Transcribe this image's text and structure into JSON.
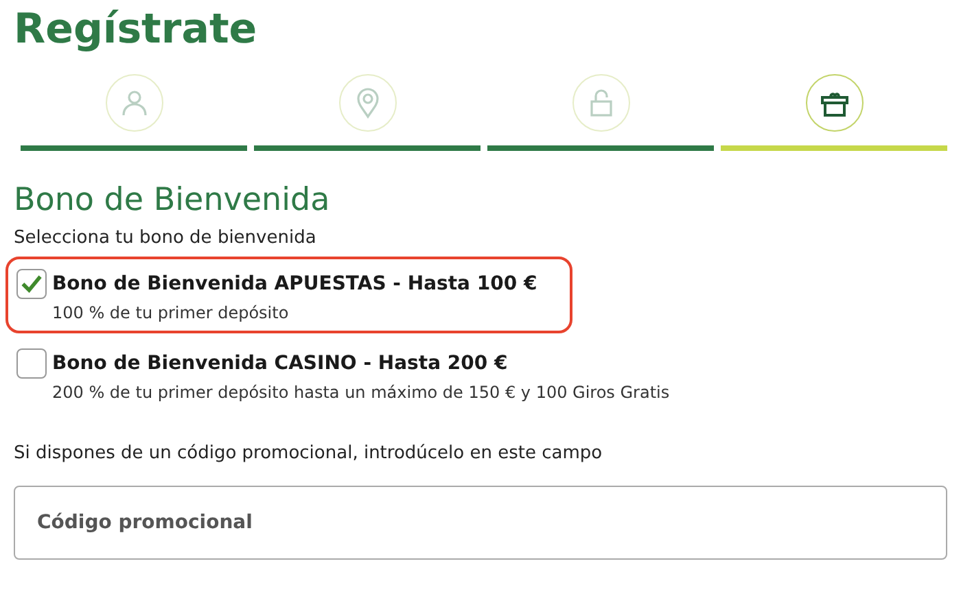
{
  "title": "Regístrate",
  "steps": [
    {
      "kind": "user",
      "selected": false
    },
    {
      "kind": "location",
      "selected": false
    },
    {
      "kind": "lock",
      "selected": false
    },
    {
      "kind": "gift",
      "selected": true
    }
  ],
  "section_title": "Bono de Bienvenida",
  "instruction": "Selecciona tu bono de bienvenida",
  "bonuses": [
    {
      "title": "Bono de Bienvenida APUESTAS - Hasta 100 €",
      "description": "100 % de tu primer depósito",
      "checked": true
    },
    {
      "title": "Bono de Bienvenida CASINO - Hasta 200 €",
      "description": "200 % de tu primer depósito hasta un máximo de 150 € y 100 Giros Gratis",
      "checked": false
    }
  ],
  "promo_hint": "Si dispones de un código promocional, introdúcelo en este campo",
  "promo_field": {
    "placeholder": "Código promocional"
  }
}
